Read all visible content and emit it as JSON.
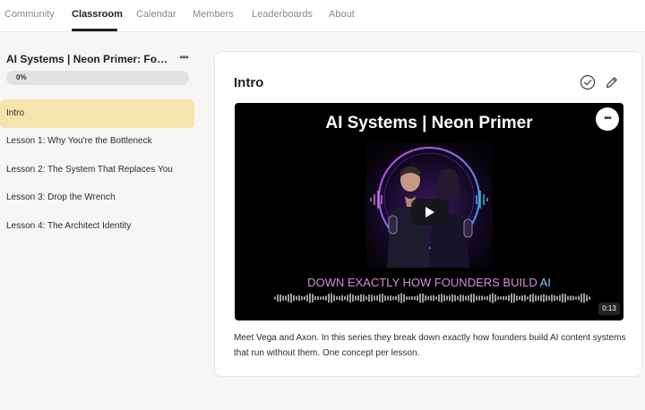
{
  "nav": {
    "tabs": [
      {
        "label": "Community"
      },
      {
        "label": "Classroom",
        "active": true
      },
      {
        "label": "Calendar"
      },
      {
        "label": "Members"
      },
      {
        "label": "Leaderboards"
      },
      {
        "label": "About"
      }
    ]
  },
  "sidebar": {
    "course_title": "AI Systems | Neon Primer: Founders...",
    "more_icon": "more-horizontal-icon",
    "progress": {
      "label": "0%",
      "fraction": 0.0,
      "color": "#e6c64e"
    },
    "lessons": [
      {
        "label": "Intro",
        "active": true
      },
      {
        "label": "Lesson 1: Why You're the Bottleneck"
      },
      {
        "label": "Lesson 2: The System That Replaces You"
      },
      {
        "label": "Lesson 3: Drop the Wrench"
      },
      {
        "label": "Lesson 4: The Architect Identity"
      }
    ],
    "active_color": "#f7e3ac"
  },
  "main": {
    "title": "Intro",
    "complete_icon": "check-circle-icon",
    "edit_icon": "pencil-icon",
    "video": {
      "headline": "AI Systems | Neon Primer",
      "caption_main": "DOWN EXACTLY HOW FOUNDERS BUILD ",
      "caption_ai": "AI",
      "duration": "0:13",
      "play_icon": "play-icon",
      "more_icon": "more-horizontal-icon"
    },
    "description": "Meet Vega and Axon. In this series they break down exactly how founders build AI content systems that run without them. One concept per lesson."
  }
}
